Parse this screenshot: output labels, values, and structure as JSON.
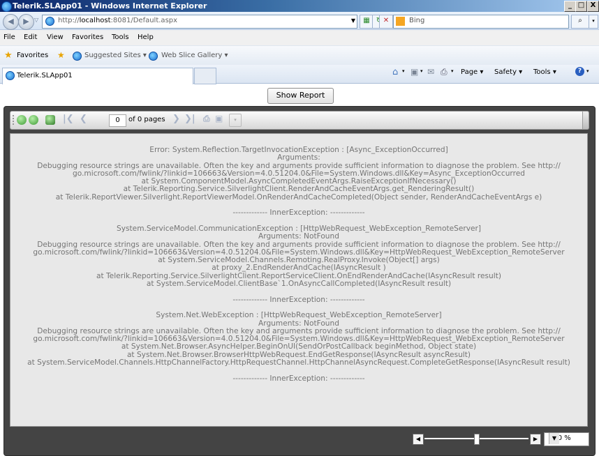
{
  "window": {
    "title": "Telerik.SLApp01 - Windows Internet Explorer",
    "min": "_",
    "max": "□",
    "close": "X"
  },
  "address": {
    "prefix": "http://",
    "host": "localhost",
    "rest": ":8081/Default.aspx"
  },
  "search": {
    "engine": "Bing"
  },
  "menu": [
    "File",
    "Edit",
    "View",
    "Favorites",
    "Tools",
    "Help"
  ],
  "favorites": {
    "label": "Favorites",
    "suggested": "Suggested Sites ▾",
    "webslice": "Web Slice Gallery ▾"
  },
  "tab": {
    "title": "Telerik.SLApp01"
  },
  "commandbar": {
    "page": "Page ▾",
    "safety": "Safety ▾",
    "tools": "Tools ▾"
  },
  "report": {
    "show_button": "Show Report",
    "page_number": "0",
    "page_label": "of 0 pages",
    "zoom": "100 %",
    "error_text": "Error: System.Reflection.TargetInvocationException : [Async_ExceptionOccurred]\nArguments:\nDebugging resource strings are unavailable. Often the key and arguments provide sufficient information to diagnose the problem. See http://\ngo.microsoft.com/fwlink/?linkid=106663&Version=4.0.51204.0&File=System.Windows.dll&Key=Async_ExceptionOccurred\nat System.ComponentModel.AsyncCompletedEventArgs.RaiseExceptionIfNecessary()\nat Telerik.Reporting.Service.SilverlightClient.RenderAndCacheEventArgs.get_RenderingResult()\nat Telerik.ReportViewer.Silverlight.ReportViewerModel.OnRenderAndCacheCompleted(Object sender, RenderAndCacheEventArgs e)\n\n------------- InnerException: -------------\n\nSystem.ServiceModel.CommunicationException : [HttpWebRequest_WebException_RemoteServer]\nArguments: NotFound\nDebugging resource strings are unavailable. Often the key and arguments provide sufficient information to diagnose the problem. See http://\ngo.microsoft.com/fwlink/?linkid=106663&Version=4.0.51204.0&File=System.Windows.dll&Key=HttpWebRequest_WebException_RemoteServer\nat System.ServiceModel.Channels.Remoting.RealProxy.Invoke(Object[] args)\nat proxy_2.EndRenderAndCache(IAsyncResult )\nat Telerik.Reporting.Service.SilverlightClient.ReportServiceClient.OnEndRenderAndCache(IAsyncResult result)\nat System.ServiceModel.ClientBase`1.OnAsyncCallCompleted(IAsyncResult result)\n\n------------- InnerException: -------------\n\nSystem.Net.WebException : [HttpWebRequest_WebException_RemoteServer]\nArguments: NotFound\nDebugging resource strings are unavailable. Often the key and arguments provide sufficient information to diagnose the problem. See http://\ngo.microsoft.com/fwlink/?linkid=106663&Version=4.0.51204.0&File=System.Windows.dll&Key=HttpWebRequest_WebException_RemoteServer\nat System.Net.Browser.AsyncHelper.BeginOnUI(SendOrPostCallback beginMethod, Object state)\nat System.Net.Browser.BrowserHttpWebRequest.EndGetResponse(IAsyncResult asyncResult)\nat System.ServiceModel.Channels.HttpChannelFactory.HttpRequestChannel.HttpChannelAsyncRequest.CompleteGetResponse(IAsyncResult result)\n\n------------- InnerException: -------------"
  }
}
